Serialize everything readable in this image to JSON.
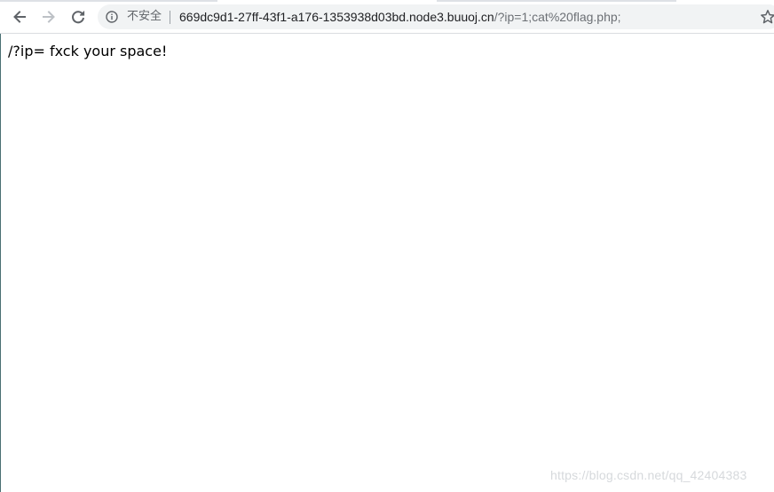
{
  "browser": {
    "security_label": "不安全",
    "url_host": "669dc9d1-27ff-43f1-a176-1353938d03bd.node3.buuoj.cn",
    "url_rest": "/?ip=1;cat%20flag.php;",
    "icons": {
      "back": "back-arrow-icon",
      "forward": "forward-arrow-icon",
      "reload": "reload-icon",
      "info": "info-icon",
      "bookmark": "star-icon"
    }
  },
  "page": {
    "body_text": "/?ip= fxck your space!"
  },
  "watermark": {
    "text": "https://blog.csdn.net/qq_42404383"
  }
}
